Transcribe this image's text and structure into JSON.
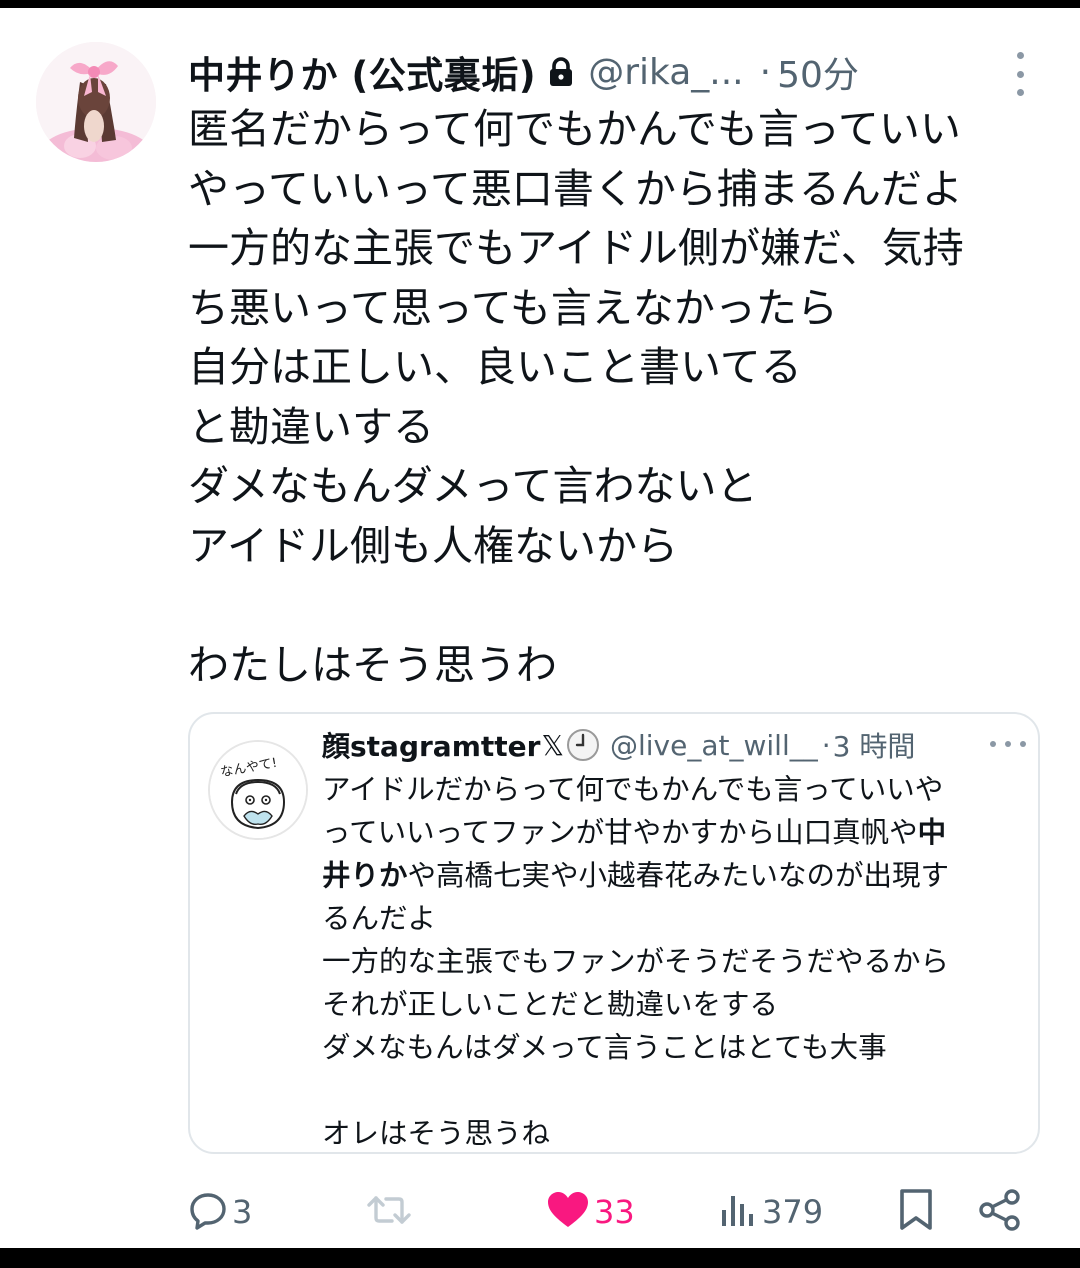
{
  "tweet": {
    "display_name": "中井りか (公式裏垢)",
    "handle": "@rika_...",
    "dot": "·",
    "time": "50分",
    "body_lines": [
      "匿名だからって何でもかんでも言っていい",
      "やっていいって悪口書くから捕まるんだよ",
      "一方的な主張でもアイドル側が嫌だ、気持",
      "ち悪いって思っても言えなかったら",
      "自分は正しい、良いこと書いてる",
      "と勘違いする",
      "ダメなもんダメって言わないと",
      "アイドル側も人権ないから",
      "",
      "わたしはそう思うわ"
    ]
  },
  "quote": {
    "display_name": "顔stagramtter",
    "x_glyph": "𝕏",
    "handle": "@live_at_will__",
    "dot": "·",
    "time": "3 時間",
    "avatar_caption": "なんやて!",
    "body_lines": [
      {
        "text": "アイドルだからって何でもかんでも言っていいや"
      },
      {
        "pre": "っていいってファンが甘やかすから山口真帆や",
        "bold": "中"
      },
      {
        "bold": "井りか",
        "post": "や高橋七実や小越春花みたいなのが出現す"
      },
      {
        "text": "るんだよ"
      },
      {
        "text": "一方的な主張でもファンがそうだそうだやるから"
      },
      {
        "text": "それが正しいことだと勘違いをする"
      },
      {
        "text": "ダメなもんはダメって言うことはとても大事"
      },
      {
        "text": ""
      },
      {
        "text": "オレはそう思うね"
      }
    ]
  },
  "actions": {
    "replies": "3",
    "reposts": "",
    "likes": "33",
    "views": "379"
  },
  "colors": {
    "text": "#0f1419",
    "muted": "#536471",
    "like": "#f91880"
  },
  "icons": [
    "lock-icon",
    "more-icon",
    "clock-icon",
    "reply-icon",
    "repost-icon",
    "like-icon",
    "views-icon",
    "bookmark-icon",
    "share-icon"
  ]
}
